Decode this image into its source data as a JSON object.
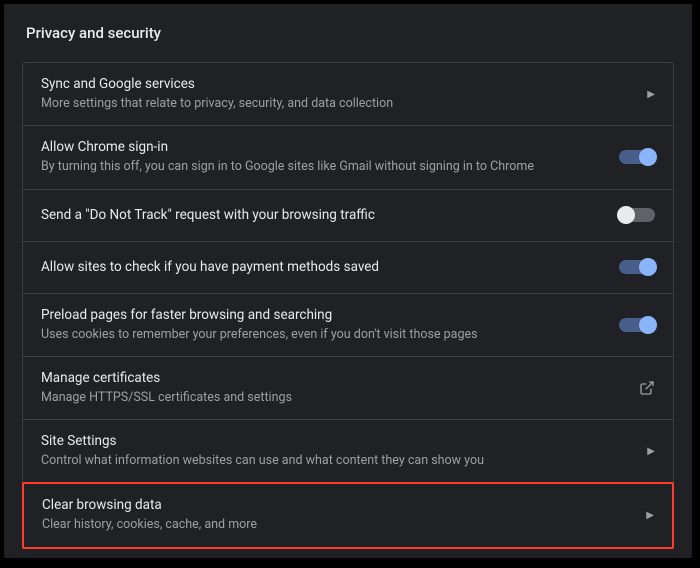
{
  "section": {
    "title": "Privacy and security"
  },
  "rows": [
    {
      "title": "Sync and Google services",
      "subtitle": "More settings that relate to privacy, security, and data collection",
      "action": "chevron"
    },
    {
      "title": "Allow Chrome sign-in",
      "subtitle": "By turning this off, you can sign in to Google sites like Gmail without signing in to Chrome",
      "action": "toggle",
      "state": "on"
    },
    {
      "title": "Send a \"Do Not Track\" request with your browsing traffic",
      "subtitle": "",
      "action": "toggle",
      "state": "off"
    },
    {
      "title": "Allow sites to check if you have payment methods saved",
      "subtitle": "",
      "action": "toggle",
      "state": "on"
    },
    {
      "title": "Preload pages for faster browsing and searching",
      "subtitle": "Uses cookies to remember your preferences, even if you don't visit those pages",
      "action": "toggle",
      "state": "on"
    },
    {
      "title": "Manage certificates",
      "subtitle": "Manage HTTPS/SSL certificates and settings",
      "action": "external"
    },
    {
      "title": "Site Settings",
      "subtitle": "Control what information websites can use and what content they can show you",
      "action": "chevron"
    },
    {
      "title": "Clear browsing data",
      "subtitle": "Clear history, cookies, cache, and more",
      "action": "chevron",
      "highlighted": true
    }
  ]
}
